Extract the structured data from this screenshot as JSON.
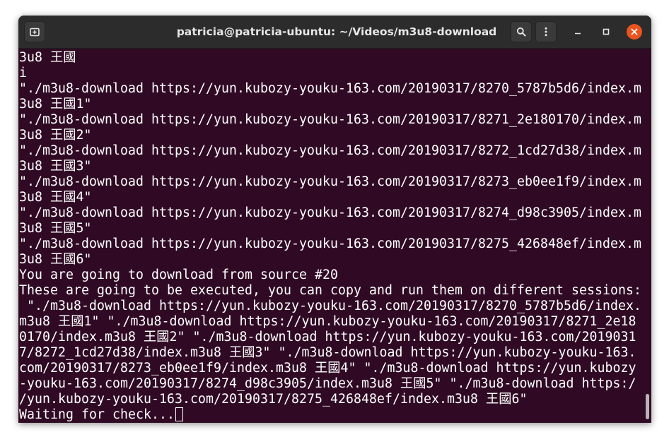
{
  "window": {
    "title": "patricia@patricia-ubuntu: ~/Videos/m3u8-download",
    "controls": {
      "new_tab": "new-tab-icon",
      "search": "search-icon",
      "menu": "kebab-menu-icon",
      "minimize": "minimize-icon",
      "maximize": "maximize-icon",
      "close": "close-icon"
    },
    "colors": {
      "titlebar": "#2c2c2c",
      "terminal_bg": "#300a24",
      "terminal_fg": "#ffffff",
      "close_button": "#e95420"
    }
  },
  "terminal": {
    "lines": [
      "3u8 王國",
      "i",
      "\"./m3u8-download https://yun.kubozy-youku-163.com/20190317/8270_5787b5d6/index.m",
      "3u8 王國1\"",
      "\"./m3u8-download https://yun.kubozy-youku-163.com/20190317/8271_2e180170/index.m",
      "3u8 王國2\"",
      "\"./m3u8-download https://yun.kubozy-youku-163.com/20190317/8272_1cd27d38/index.m",
      "3u8 王國3\"",
      "\"./m3u8-download https://yun.kubozy-youku-163.com/20190317/8273_eb0ee1f9/index.m",
      "3u8 王國4\"",
      "\"./m3u8-download https://yun.kubozy-youku-163.com/20190317/8274_d98c3905/index.m",
      "3u8 王國5\"",
      "\"./m3u8-download https://yun.kubozy-youku-163.com/20190317/8275_426848ef/index.m",
      "3u8 王國6\"",
      "You are going to download from source #20",
      "These are going to be executed, you can copy and run them on different sessions:",
      " \"./m3u8-download https://yun.kubozy-youku-163.com/20190317/8270_5787b5d6/index.",
      "m3u8 王國1\" \"./m3u8-download https://yun.kubozy-youku-163.com/20190317/8271_2e18",
      "0170/index.m3u8 王國2\" \"./m3u8-download https://yun.kubozy-youku-163.com/2019031",
      "7/8272_1cd27d38/index.m3u8 王國3\" \"./m3u8-download https://yun.kubozy-youku-163.",
      "com/20190317/8273_eb0ee1f9/index.m3u8 王國4\" \"./m3u8-download https://yun.kubozy",
      "-youku-163.com/20190317/8274_d98c3905/index.m3u8 王國5\" \"./m3u8-download https:/",
      "/yun.kubozy-youku-163.com/20190317/8275_426848ef/index.m3u8 王國6\""
    ],
    "prompt_line": "Waiting for check..."
  }
}
